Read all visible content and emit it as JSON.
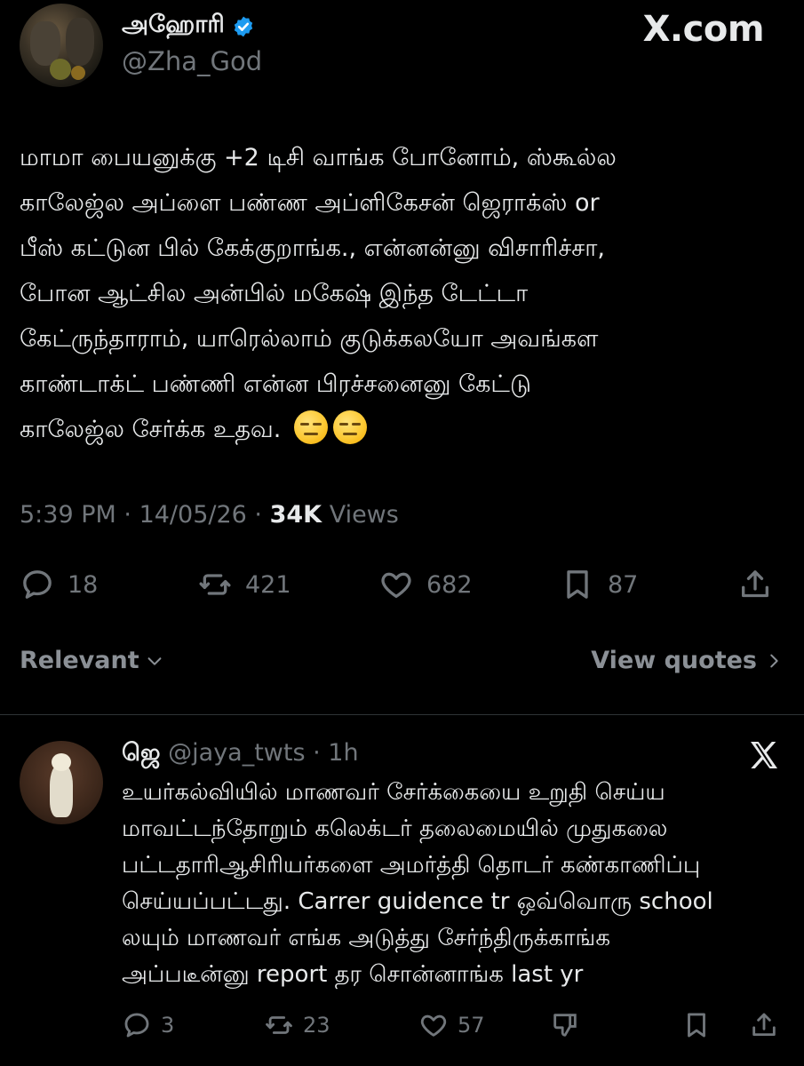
{
  "header": {
    "display_name": "அஹோரி",
    "handle": "@Zha_God",
    "brand": "X.com"
  },
  "tweet": {
    "lines": [
      "மாமா பையனுக்கு +2 டிசி வாங்க போனோம், ஸ்கூல்ல",
      "காலேஜ்ல அப்ளை பண்ண அப்ளிகேசன் ஜெராக்ஸ் or",
      "பீஸ் கட்டுன பில் கேக்குறாங்க., என்னன்னு விசாரிச்சா,",
      "போன ஆட்சில அன்பில் மகேஷ் இந்த டேட்டா",
      "கேட்ருந்தாராம், யாரெல்லாம் குடுக்கலயோ அவங்கள",
      "காண்டாக்ட் பண்ணி என்ன பிரச்சனைனு கேட்டு",
      "காலேஜ்ல சேர்க்க உதவ."
    ],
    "time": "5:39 PM",
    "date": "14/05/26",
    "views_count": "34K",
    "views_label": "Views",
    "replies": "18",
    "reposts": "421",
    "likes": "682",
    "bookmarks": "87"
  },
  "sort": {
    "relevant": "Relevant",
    "view_quotes": "View quotes"
  },
  "reply": {
    "name": "ஜெ",
    "handle": "@jaya_twts",
    "time": "1h",
    "lines": [
      "உயர்கல்வியில் மாணவர் சேர்க்கையை உறுதி செய்ய",
      "மாவட்டந்தோறும் கலெக்டர் தலைமையில் முதுகலை",
      "பட்டதாரிஆசிரியர்களை அமர்த்தி தொடர் கண்காணிப்பு",
      "செய்யப்பட்டது. Carrer guidence tr ஒவ்வொரு school",
      "லயும் மாணவர் எங்க அடுத்து சேர்ந்திருக்காங்க",
      "அப்படீன்னு report தர சொன்னாங்க last yr"
    ],
    "replies": "3",
    "reposts": "23",
    "likes": "57"
  },
  "colors": {
    "background": "#000000",
    "text": "#e7e9ea",
    "secondary": "#71767b",
    "verified": "#1d9bf0"
  },
  "icons": [
    "verified-badge-icon",
    "reply-icon",
    "repost-icon",
    "like-icon",
    "bookmark-icon",
    "share-icon",
    "chevron-down-icon",
    "chevron-right-icon",
    "x-logo-icon",
    "dislike-icon"
  ]
}
